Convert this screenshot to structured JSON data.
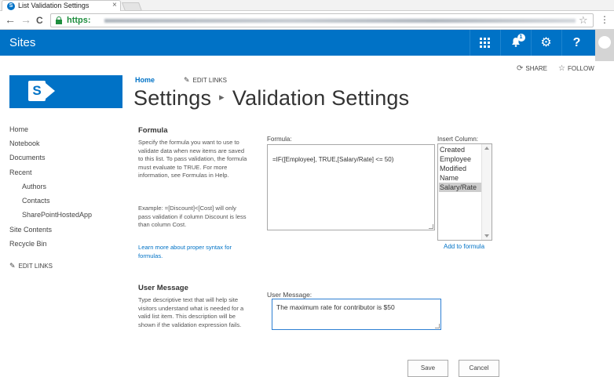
{
  "browser": {
    "tab_title": "List Validation Settings",
    "tab_icon_letter": "S",
    "tab_close": "×",
    "url_scheme": "https:",
    "back_icon": "←",
    "forward_icon": "→",
    "reload_icon": "C",
    "star_icon": "☆",
    "menu_icon": "⋮"
  },
  "suitebar": {
    "title": "Sites",
    "notification_count": "1",
    "help_label": "?",
    "gear_label": "⚙",
    "bell_label": "🔔"
  },
  "page_actions": {
    "share_label": "SHARE",
    "follow_label": "FOLLOW",
    "share_icon": "⟳",
    "follow_icon": "☆"
  },
  "logo": {
    "letter": "S"
  },
  "top_links": {
    "home": "Home",
    "edit_links": "EDIT LINKS"
  },
  "page_title": {
    "part1": "Settings",
    "separator": "▸",
    "part2": "Validation Settings"
  },
  "left_nav": {
    "items": [
      {
        "label": "Home"
      },
      {
        "label": "Notebook"
      },
      {
        "label": "Documents"
      },
      {
        "label": "Recent"
      },
      {
        "label": "Authors"
      },
      {
        "label": "Contacts"
      },
      {
        "label": "SharePointHostedApp"
      },
      {
        "label": "Site Contents"
      },
      {
        "label": "Recycle Bin"
      }
    ],
    "edit_links": "EDIT LINKS"
  },
  "formula_section": {
    "title": "Formula",
    "description": "Specify the formula you want to use to validate data when new items are saved to this list. To pass validation, the formula must evaluate to TRUE. For more information, see Formulas in Help.",
    "example": "Example: =[Discount]<[Cost] will only pass validation if column Discount is less than column Cost.",
    "link": "Learn more about proper syntax for formulas.",
    "formula_label": "Formula:",
    "formula_value": "=IF([Employee], TRUE,[Salary/Rate] <= 50)",
    "insert_column_label": "Insert Column:",
    "columns": [
      "Created",
      "Employee",
      "Modified",
      "Name",
      "Salary/Rate"
    ],
    "selected_column": "Salary/Rate",
    "add_to_formula": "Add to formula"
  },
  "user_message_section": {
    "title": "User Message",
    "description": "Type descriptive text that will help site visitors understand what is needed for a valid list item. This description will be shown if the validation expression fails.",
    "field_label": "User Message:",
    "field_value": "The maximum rate for contributor is $50"
  },
  "buttons": {
    "save": "Save",
    "cancel": "Cancel"
  },
  "colors": {
    "brand": "#0072c6",
    "link": "#0072c6",
    "focus_border": "#2d7fd3"
  }
}
